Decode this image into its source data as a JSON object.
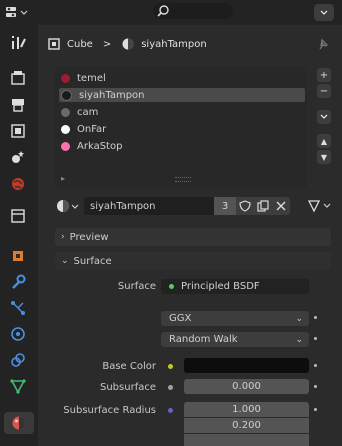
{
  "breadcrumb": {
    "object": "Cube",
    "separator": ">",
    "material": "siyahTampon"
  },
  "materials": [
    {
      "name": "temel",
      "color": "#9b1b30"
    },
    {
      "name": "siyahTampon",
      "color": "#1a1a1a"
    },
    {
      "name": "cam",
      "color": "#6a6a6a"
    },
    {
      "name": "OnFar",
      "color": "#ffffff"
    },
    {
      "name": "ArkaStop",
      "color": "#ff6fb5"
    }
  ],
  "list_buttons": {
    "add": "+",
    "remove": "−",
    "menu": "⌄",
    "up": "▲",
    "down": "▼"
  },
  "material_bar": {
    "name": "siyahTampon",
    "users": "3"
  },
  "panels": {
    "preview": "Preview",
    "surface": "Surface"
  },
  "surface": {
    "surface_label": "Surface",
    "shader": "Principled BSDF",
    "distribution": "GGX",
    "subsurface_method": "Random Walk",
    "base_color_label": "Base Color",
    "base_color": "#0d0d0d",
    "subsurface_label": "Subsurface",
    "subsurface_value": "0.000",
    "subsurface_radius_label": "Subsurface Radius",
    "subsurface_radius": [
      "1.000",
      "0.200"
    ]
  },
  "colors": {
    "accent": "#4772b3",
    "green": "#63c763",
    "yellow": "#c7c729",
    "blue_socket": "#6363c7"
  }
}
